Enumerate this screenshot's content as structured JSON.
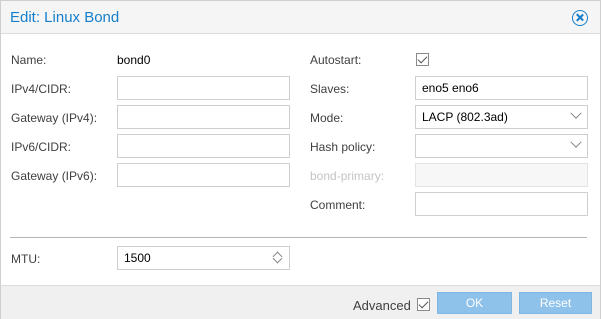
{
  "window": {
    "title": "Edit: Linux Bond"
  },
  "left": {
    "name_label": "Name:",
    "name_value": "bond0",
    "ipv4_label": "IPv4/CIDR:",
    "ipv4_value": "",
    "gw4_label": "Gateway (IPv4):",
    "gw4_value": "",
    "ipv6_label": "IPv6/CIDR:",
    "ipv6_value": "",
    "gw6_label": "Gateway (IPv6):",
    "gw6_value": ""
  },
  "right": {
    "autostart_label": "Autostart:",
    "autostart_checked": true,
    "slaves_label": "Slaves:",
    "slaves_value": "eno5 eno6",
    "mode_label": "Mode:",
    "mode_value": "LACP (802.3ad)",
    "hash_label": "Hash policy:",
    "hash_value": "",
    "bondprimary_label": "bond-primary:",
    "bondprimary_value": "",
    "comment_label": "Comment:",
    "comment_value": ""
  },
  "advanced": {
    "mtu_label": "MTU:",
    "mtu_value": "1500"
  },
  "footer": {
    "advanced_label": "Advanced",
    "advanced_checked": true,
    "ok_label": "OK",
    "reset_label": "Reset"
  },
  "colors": {
    "accent": "#157fcc",
    "button": "#8fc2ea",
    "titlebar": "#f5f5f5"
  },
  "icons": {
    "close": "close-circle-icon",
    "checkbox": "checkmark-icon",
    "dropdown": "chevron-down-icon",
    "spinner": "spinner-arrows-icon"
  }
}
